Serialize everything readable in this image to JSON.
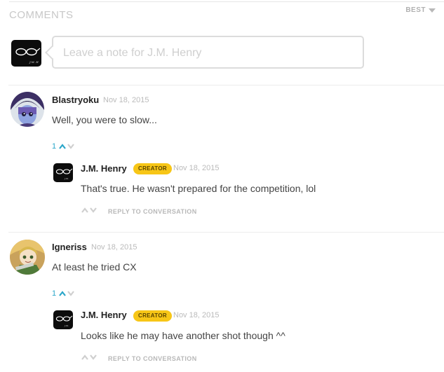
{
  "header": {
    "title": "COMMENTS",
    "sort_label": "BEST"
  },
  "compose": {
    "placeholder": "Leave a note for J.M. Henry"
  },
  "comments": [
    {
      "author": "Blastryoku",
      "date": "Nov 18, 2015",
      "text": "Well, you were to slow...",
      "vote_count": "1",
      "reply": {
        "author": "J.M. Henry",
        "badge": "CREATOR",
        "date": "Nov 18, 2015",
        "text": "That's true. He wasn't prepared for the competition, lol",
        "reply_label": "REPLY TO CONVERSATION"
      }
    },
    {
      "author": "Igneriss",
      "date": "Nov 18, 2015",
      "text": "At least he tried CX",
      "vote_count": "1",
      "reply": {
        "author": "J.M. Henry",
        "badge": "CREATOR",
        "date": "Nov 18, 2015",
        "text": "Looks like he may have another shot though ^^",
        "reply_label": "REPLY TO CONVERSATION"
      }
    }
  ],
  "colors": {
    "accent": "#2aa6c9",
    "badge": "#f7c617",
    "border": "#dcdcdc",
    "muted": "#bbbbbb"
  }
}
